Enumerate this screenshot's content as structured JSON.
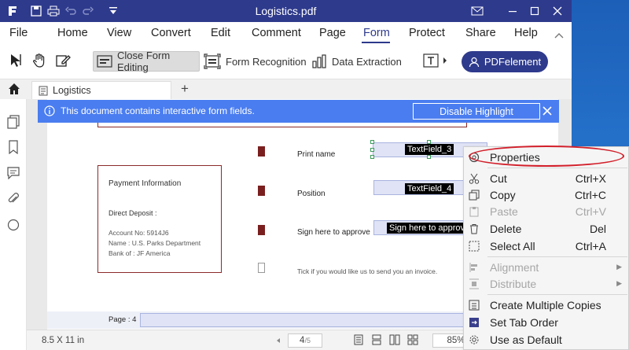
{
  "window": {
    "title": "Logistics.pdf",
    "controls": [
      "minimize-icon",
      "maximize-icon",
      "close-icon"
    ]
  },
  "menubar": {
    "items": [
      "File",
      "Home",
      "View",
      "Convert",
      "Edit",
      "Comment",
      "Page",
      "Form",
      "Protect",
      "Share",
      "Help"
    ],
    "active": "Form"
  },
  "toolbar": {
    "close_form_editing": "Close Form Editing",
    "form_recognition": "Form Recognition",
    "data_extraction": "Data Extraction",
    "pdfelement": "PDFelement"
  },
  "tabs": {
    "doc_tab": "Logistics",
    "add": "+"
  },
  "banner": {
    "message": "This document contains interactive form fields.",
    "disable_highlight": "Disable Highlight"
  },
  "document": {
    "payment": {
      "heading": "Payment Information",
      "direct_deposit": "Direct Deposit :",
      "account": "Account No: 5914J6",
      "name": "Name :  U.S. Parks Department",
      "bank": "Bank of : JF America"
    },
    "fields": {
      "print_name_label": "Print name",
      "position_label": "Position",
      "sign_label": "Sign here to approve",
      "invoice_label": "Tick if you would like us to send you an invoice.",
      "textfield3": "TextField_3",
      "textfield4": "TextField_4",
      "sign_field": "Sign here to approve"
    },
    "page_label": "Page : 4"
  },
  "statusbar": {
    "page_size": "8.5 X 11 in",
    "current_page": "4",
    "total_pages": "/5",
    "zoom": "85%"
  },
  "context_menu": {
    "properties": "Properties",
    "cut": "Cut",
    "cut_sc": "Ctrl+X",
    "copy": "Copy",
    "copy_sc": "Ctrl+C",
    "paste": "Paste",
    "paste_sc": "Ctrl+V",
    "delete": "Delete",
    "delete_sc": "Del",
    "select_all": "Select All",
    "select_all_sc": "Ctrl+A",
    "alignment": "Alignment",
    "distribute": "Distribute",
    "create_copies": "Create Multiple Copies",
    "tab_order": "Set Tab Order",
    "use_default": "Use as Default"
  },
  "colors": {
    "brand": "#2e3a8c",
    "banner": "#4a7df0",
    "form_border": "#8b2a2a",
    "highlight_oval": "#d21f2a"
  }
}
